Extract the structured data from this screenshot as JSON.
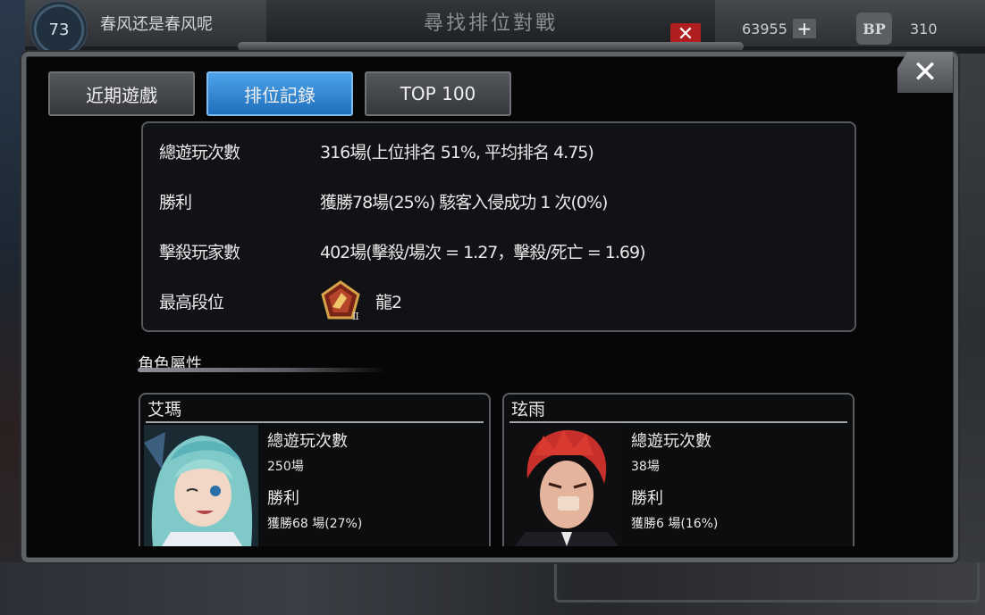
{
  "background": {
    "player_level": "73",
    "player_name": "春风还是春风呢",
    "top_title": "尋找排位對戰",
    "currency_amount": "63955",
    "bp_label": "BP",
    "bp_amount": "310"
  },
  "tabs": [
    {
      "label": "近期遊戲",
      "active": false
    },
    {
      "label": "排位記錄",
      "active": true
    },
    {
      "label": "TOP 100",
      "active": false
    }
  ],
  "stats": {
    "total_games_label": "總遊玩次數",
    "total_games_value": "316場(上位排名 51%, 平均排名 4.75)",
    "wins_label": "勝利",
    "wins_value": "獲勝78場(25%) 駭客入侵成功 1 次(0%)",
    "kills_label": "擊殺玩家數",
    "kills_value": "402場(擊殺/場次 = 1.27，擊殺/死亡 = 1.69)",
    "highest_rank_label": "最高段位",
    "highest_rank_value": "龍2",
    "highest_rank_badge_numeral": "II"
  },
  "character_section_title": "角色屬性",
  "characters": [
    {
      "name": "艾瑪",
      "games_label": "總遊玩次數",
      "games_value": "250場",
      "wins_label": "勝利",
      "wins_value": "獲勝68 場(27%)"
    },
    {
      "name": "玹雨",
      "games_label": "總遊玩次數",
      "games_value": "38場",
      "wins_label": "勝利",
      "wins_value": "獲勝6 場(16%)"
    }
  ],
  "icons": {
    "close": "close-icon",
    "plus": "plus-icon",
    "bp": "bp-icon",
    "rank_badge": "dragon-rank-badge-icon"
  },
  "colors": {
    "active_tab": "#2f86d6",
    "modal_bg": "#060607",
    "frame": "#5e6166",
    "close_red": "#b01f1f"
  }
}
